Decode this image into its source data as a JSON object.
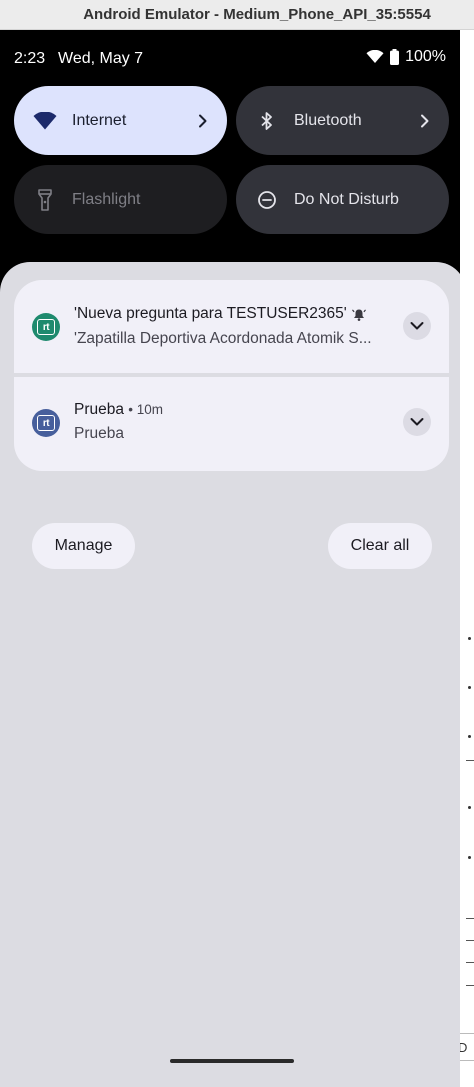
{
  "window": {
    "title": "Android Emulator - Medium_Phone_API_35:5554"
  },
  "status_bar": {
    "time": "2:23",
    "date": "Wed, May 7",
    "battery": "100%"
  },
  "quick_settings": {
    "tiles": [
      {
        "label": "Internet",
        "icon": "wifi-icon",
        "state": "on"
      },
      {
        "label": "Bluetooth",
        "icon": "bluetooth-icon",
        "state": "off"
      },
      {
        "label": "Flashlight",
        "icon": "flashlight-icon",
        "state": "unavailable"
      },
      {
        "label": "Do Not Disturb",
        "icon": "do-not-disturb-icon",
        "state": "off"
      }
    ]
  },
  "notifications": [
    {
      "app_icon_text": "rt",
      "title": "'Nueva pregunta para TESTUSER2365'",
      "text": "'Zapatilla Deportiva Acordonada Atomik S...",
      "alert_icon": "bell-icon",
      "icon_color": "#1e8a6e"
    },
    {
      "app_icon_text": "rt",
      "title": "Prueba",
      "time": "• 10m",
      "text": "Prueba",
      "icon_color": "#475f9c"
    }
  ],
  "actions": {
    "manage": "Manage",
    "clear_all": "Clear all"
  },
  "side_panel": {
    "box_label": "D"
  },
  "colors": {
    "shade_bg": "#dcdce2",
    "card_bg": "#f1f0f8",
    "internet_tile_bg": "#dde3fd",
    "tile_bg": "#32333a"
  }
}
